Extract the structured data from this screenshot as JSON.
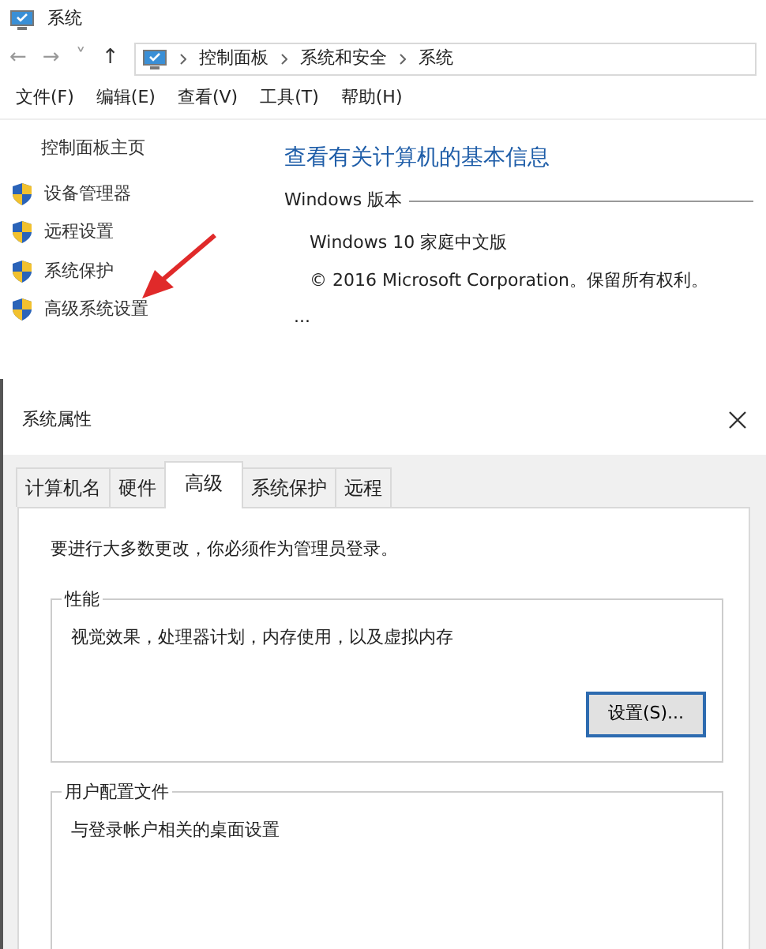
{
  "window": {
    "title": "系统"
  },
  "nav": [
    "←",
    "→",
    "˅",
    "↑"
  ],
  "breadcrumb": [
    "控制面板",
    "系统和安全",
    "系统"
  ],
  "menu": [
    "文件(F)",
    "编辑(E)",
    "查看(V)",
    "工具(T)",
    "帮助(H)"
  ],
  "sidebar": {
    "home": "控制面板主页",
    "items": [
      {
        "label": "设备管理器"
      },
      {
        "label": "远程设置"
      },
      {
        "label": "系统保护"
      },
      {
        "label": "高级系统设置"
      }
    ]
  },
  "main": {
    "heading": "查看有关计算机的基本信息",
    "section": "Windows 版本",
    "lines": [
      "Windows 10 家庭中文版",
      "© 2016 Microsoft Corporation。保留所有权利。"
    ],
    "more": "..."
  },
  "dialog": {
    "title": "系统属性",
    "tabs": [
      {
        "label": "计算机名",
        "selected": false
      },
      {
        "label": "硬件",
        "selected": false
      },
      {
        "label": "高级",
        "selected": true
      },
      {
        "label": "系统保护",
        "selected": false
      },
      {
        "label": "远程",
        "selected": false
      }
    ],
    "note": "要进行大多数更改，你必须作为管理员登录。",
    "groups": [
      {
        "title": "性能",
        "text": "视觉效果，处理器计划，内存使用，以及虚拟内存",
        "button": "设置(S)..."
      },
      {
        "title": "用户配置文件",
        "text": "与登录帐户相关的桌面设置"
      }
    ]
  }
}
